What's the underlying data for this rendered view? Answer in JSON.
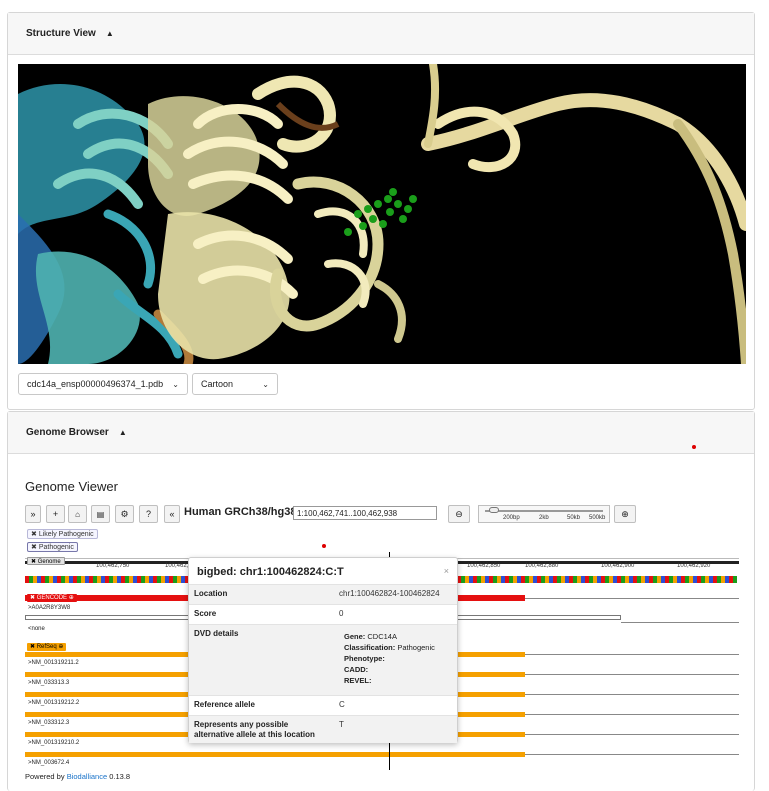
{
  "structure": {
    "title": "Structure View",
    "pdb_file": "cdc14a_ensp00000496374_1.pdb",
    "style": "Cartoon"
  },
  "genome_browser": {
    "title": "Genome Browser",
    "viewer_title": "Genome Viewer",
    "genome": "Human GRCh38/hg38",
    "location": "1:100,462,741..100,462,938",
    "toolbar": [
      "»",
      "+",
      "⛵",
      "🖶",
      "⚙",
      "?",
      "«"
    ],
    "zoom_labels": [
      "200bp",
      "2kb",
      "50kb",
      "500kb"
    ],
    "filters": [
      "Likely Pathogenic",
      "Pathogenic"
    ],
    "ruler": [
      "100,462,750",
      "100,462,7",
      "100,462,850",
      "100,462,880",
      "100,462,900",
      "100,462,920"
    ],
    "tracks": {
      "genome": "Genome",
      "gencode": "GENCODE",
      "gencode_sub1": ">A0A2R8Y3W8",
      "gencode_sub2": "<none",
      "refseq": "RefSeq",
      "transcripts": [
        ">NM_001319211.2",
        ">NM_033313.3",
        ">NM_001319212.2",
        ">NM_033312.3",
        ">NM_001319210.2",
        ">NM_003672.4"
      ]
    },
    "powered_prefix": "Powered by ",
    "powered_link": "Biodalliance",
    "powered_version": " 0.13.8"
  },
  "popup": {
    "title": "bigbed: chr1:100462824:C:T",
    "close": "×",
    "location_label": "Location",
    "location_value": "chr1:100462824-100462824",
    "score_label": "Score",
    "score_value": "0",
    "dvd_label": "DVD details",
    "gene_label": "Gene:",
    "gene_value": "CDC14A",
    "class_label": "Classification:",
    "class_value": "Pathogenic",
    "phenotype_label": "Phenotype:",
    "cadd_label": "CADD:",
    "revel_label": "REVEL:",
    "ref_label": "Reference allele",
    "ref_value": "C",
    "alt_label": "Represents any possible alternative allele at this location",
    "alt_value": "T"
  },
  "colors": {
    "gencode": "#e51010",
    "refseq": "#f5a000",
    "accent": "#1a73c9"
  }
}
